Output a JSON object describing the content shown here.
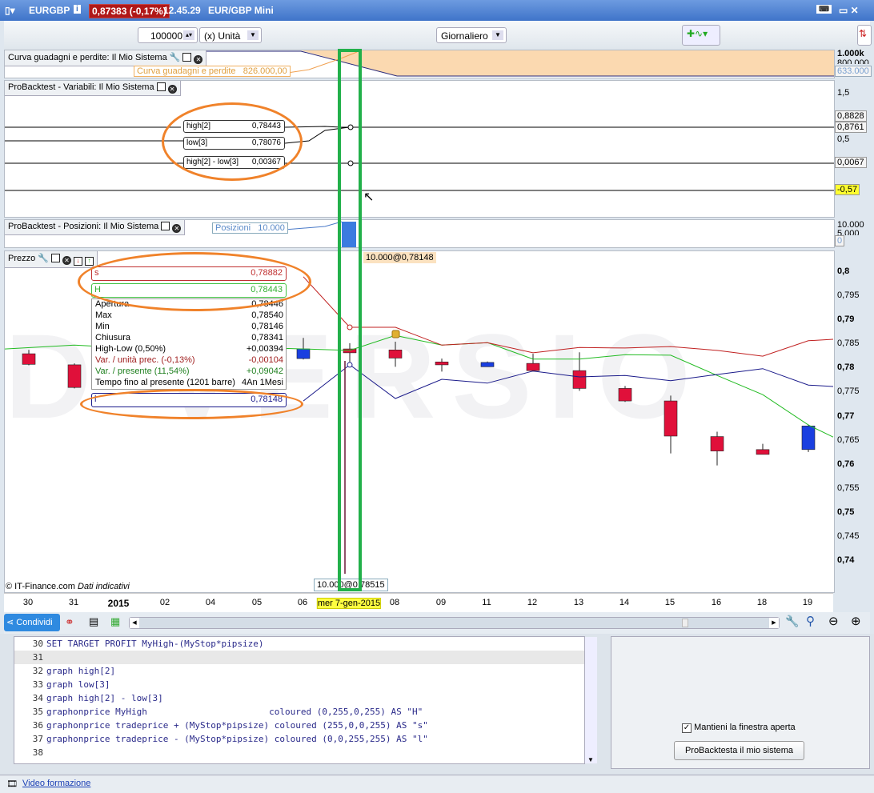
{
  "titlebar": {
    "symbol": "EURGBP",
    "price": "0,87383 (-0,17%)",
    "time": "12.45.29",
    "instrument": "EUR/GBP Mini"
  },
  "toolbar": {
    "quantity": "100000",
    "unit": "(x) Unità",
    "period": "Giornaliero"
  },
  "panels": {
    "equity": {
      "title": "Curva guadagni e perdite: Il Mio Sistema",
      "legend": "Curva guadagni e perdite",
      "legend_value": "826.000,00",
      "axis_top": "1.000k",
      "axis_2": "800.000",
      "axis_box": "633.000"
    },
    "vars": {
      "title": "ProBacktest - Variabili: Il Mio Sistema",
      "labels": [
        {
          "name": "high[2]",
          "value": "0,78443"
        },
        {
          "name": "low[3]",
          "value": "0,78076"
        },
        {
          "name": "high[2] - low[3]",
          "value": "0,00367"
        }
      ],
      "axis": {
        "t1": "1,5",
        "b1": "0,8828",
        "b2": "0,8761",
        "t2": "0,5",
        "b3": "0,0067",
        "b4": "-0,57"
      }
    },
    "positions": {
      "title": "ProBacktest - Posizioni: Il Mio Sistema",
      "legend": "Posizioni",
      "legend_value": "10.000",
      "axis_top": "10.000",
      "axis_2": "5.000",
      "axis_box": "0"
    },
    "price": {
      "title": "Prezzo",
      "trade_label": "10.000@0,78148",
      "entry_label": "10.000@0,78515",
      "copyright": "© IT-Finance.com",
      "copyright2": "Dati indicativi",
      "axis": [
        "0,8",
        "0,795",
        "0,79",
        "0,785",
        "0,78",
        "0,775",
        "0,77",
        "0,765",
        "0,76",
        "0,755",
        "0,75",
        "0,745",
        "0,74"
      ]
    }
  },
  "tooltip": {
    "s": {
      "name": "s",
      "value": "0,78882"
    },
    "H": {
      "name": "H",
      "value": "0,78443"
    },
    "rows": [
      {
        "k": "Apertura",
        "v": "0,78446",
        "c": "#000"
      },
      {
        "k": "Max",
        "v": "0,78540",
        "c": "#000"
      },
      {
        "k": "Min",
        "v": "0,78146",
        "c": "#000"
      },
      {
        "k": "Chiusura",
        "v": "0,78341",
        "c": "#000"
      },
      {
        "k": "High-Low (0,50%)",
        "v": "+0,00394",
        "c": "#000"
      },
      {
        "k": "Var. / unità prec. (-0,13%)",
        "v": "-0,00104",
        "c": "#a02020"
      },
      {
        "k": "Var. / presente (11,54%)",
        "v": "+0,09042",
        "c": "#208020"
      },
      {
        "k": "Tempo fino al presente (1201 barre)",
        "v": "4An 1Mesi",
        "c": "#000"
      }
    ],
    "l": {
      "name": "l",
      "value": "0,78148"
    }
  },
  "dates": [
    "30",
    "31",
    "2015",
    "02",
    "04",
    "05",
    "06",
    "mer 7-gen-2015",
    "08",
    "09",
    "11",
    "12",
    "13",
    "14",
    "15",
    "16",
    "18",
    "19"
  ],
  "bottombar": {
    "share": "Condividi"
  },
  "code": [
    {
      "n": "30",
      "t": "SET TARGET PROFIT MyHigh-(MyStop*pipsize)"
    },
    {
      "n": "31",
      "t": ""
    },
    {
      "n": "32",
      "t": "graph high[2]"
    },
    {
      "n": "33",
      "t": "graph low[3]"
    },
    {
      "n": "34",
      "t": "graph high[2] - low[3]"
    },
    {
      "n": "35",
      "t": "graphonprice MyHigh                       coloured (0,255,0,255) AS \"H\""
    },
    {
      "n": "36",
      "t": "graphonprice tradeprice + (MyStop*pipsize) coloured (255,0,0,255) AS \"s\""
    },
    {
      "n": "37",
      "t": "graphonprice tradeprice - (MyStop*pipsize) coloured (0,0,255,255) AS \"l\""
    },
    {
      "n": "38",
      "t": ""
    }
  ],
  "rightpanel": {
    "keep_open": "Mantieni la finestra aperta",
    "run": "ProBacktesta il mio sistema"
  },
  "footer": {
    "link": "Video formazione"
  },
  "chart_data": {
    "type": "candlestick",
    "dates": [
      "30",
      "31",
      "04",
      "06",
      "07",
      "08",
      "09",
      "11",
      "12",
      "13",
      "14",
      "15",
      "16",
      "18",
      "19"
    ],
    "ohlc": [
      [
        0.7832,
        0.784,
        0.7808,
        0.781
      ],
      [
        0.7809,
        0.7812,
        0.776,
        0.7762
      ],
      [
        0.7829,
        0.7832,
        0.7812,
        0.7814
      ],
      [
        0.7822,
        0.7865,
        0.782,
        0.7842
      ],
      [
        0.7842,
        0.7854,
        0.7815,
        0.7834
      ],
      [
        0.784,
        0.7857,
        0.7805,
        0.7823
      ],
      [
        0.7815,
        0.7822,
        0.7795,
        0.7809
      ],
      [
        0.7805,
        0.7816,
        0.7805,
        0.7814
      ],
      [
        0.7812,
        0.7832,
        0.7795,
        0.7797
      ],
      [
        0.7797,
        0.7835,
        0.7755,
        0.776
      ],
      [
        0.776,
        0.7765,
        0.7732,
        0.7734
      ],
      [
        0.7734,
        0.7745,
        0.7625,
        0.7661
      ],
      [
        0.766,
        0.767,
        0.76,
        0.763
      ],
      [
        0.7633,
        0.7645,
        0.7623,
        0.7623
      ],
      [
        0.7633,
        0.7685,
        0.7628,
        0.7682
      ]
    ],
    "series": [
      {
        "name": "H",
        "color": "#22bb22",
        "values": [
          0.7842,
          0.785,
          0.7845,
          0.7845,
          0.7842,
          0.7845,
          0.7842,
          0.7839,
          0.787,
          0.785,
          0.7855,
          0.7821,
          0.7821,
          0.783,
          0.7829,
          0.7787,
          0.7747,
          0.7684,
          0.7659
        ]
      },
      {
        "name": "s",
        "color": "#c02020",
        "values": [
          null,
          null,
          null,
          null,
          null,
          null,
          0.7992,
          0.7887,
          0.7887,
          0.785,
          0.7855,
          0.7834,
          0.7845,
          0.7844,
          0.7847,
          0.7839,
          0.7827,
          0.7859,
          0.7862
        ]
      },
      {
        "name": "l",
        "color": "#1a1a8a",
        "values": [
          null,
          null,
          null,
          null,
          null,
          null,
          0.7734,
          0.7809,
          0.7739,
          0.7779,
          0.7771,
          0.7796,
          0.7784,
          0.7787,
          0.7776,
          0.7789,
          0.7801,
          0.7767,
          0.7764
        ]
      }
    ],
    "ylim": [
      0.737,
      0.804
    ]
  }
}
